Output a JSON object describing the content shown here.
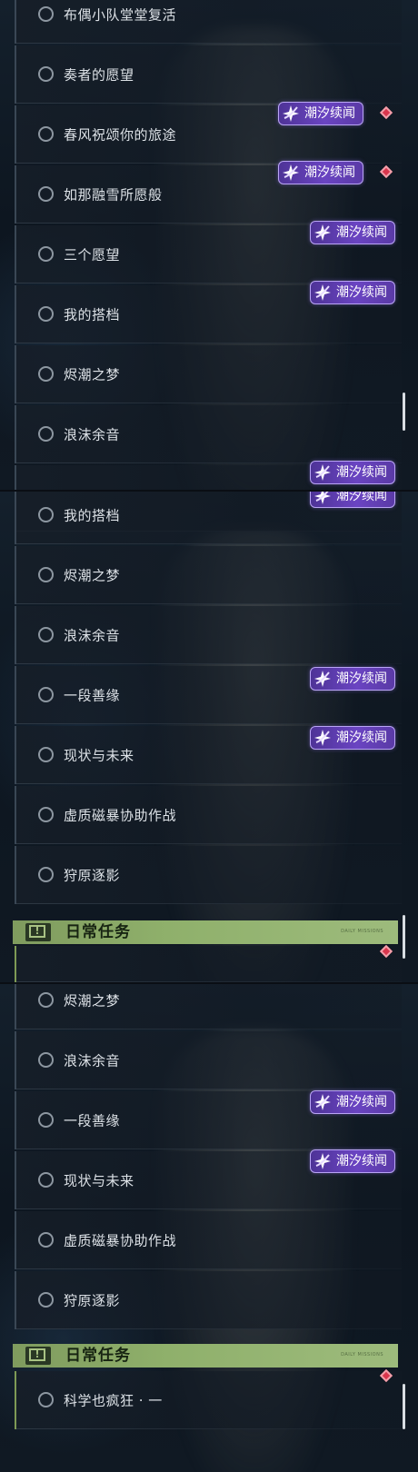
{
  "panel1": {
    "items": [
      "布偶小队堂堂复活",
      "奏者的愿望",
      "春风祝颂你的旅途",
      "如那融雪所愿般",
      "三个愿望",
      "我的搭档",
      "烬潮之梦",
      "浪沫余音"
    ]
  },
  "panel2": {
    "items": [
      "我的搭档",
      "烬潮之梦",
      "浪沫余音",
      "一段善缘",
      "现状与未来",
      "虚质磁暴协助作战",
      "狩原逐影"
    ],
    "header": {
      "title": "日常任务",
      "icon_glyph": "!",
      "subtitle": "DAILY MISSIONS"
    }
  },
  "panel3": {
    "items": [
      "烬潮之梦",
      "浪沫余音",
      "一段善缘",
      "现状与未来",
      "虚质磁暴协助作战",
      "狩原逐影"
    ],
    "header": {
      "title": "日常任务",
      "icon_glyph": "!",
      "subtitle": "DAILY MISSIONS"
    },
    "daily_item": "科学也疯狂 · 一"
  },
  "badge_label": "潮汐续闻",
  "colors": {
    "badge_purple": "#6a44c2",
    "diamond_red": "#d9364d",
    "header_green": "#8fb06b"
  }
}
